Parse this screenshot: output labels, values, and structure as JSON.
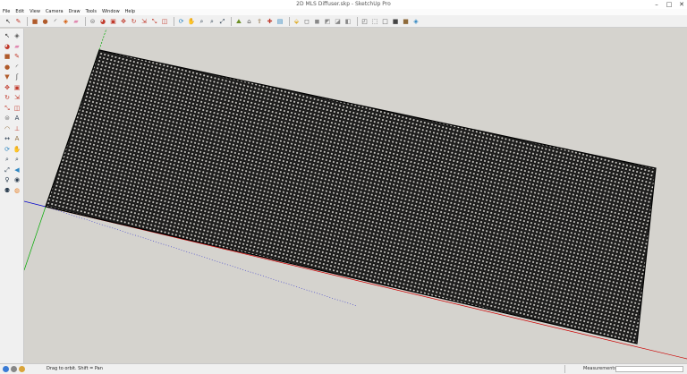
{
  "window": {
    "title": "2D MLS Diffuser.skp - SketchUp Pro"
  },
  "menu": [
    "File",
    "Edit",
    "View",
    "Camera",
    "Draw",
    "Tools",
    "Window",
    "Help"
  ],
  "toolbar_icons": [
    {
      "name": "select-icon",
      "glyph": "↖",
      "color": "#333333"
    },
    {
      "name": "pencil-icon",
      "glyph": "✎",
      "color": "#c0392b"
    },
    {
      "name": "rectangle-icon",
      "glyph": "■",
      "color": "#b05a2a"
    },
    {
      "name": "circle-icon",
      "glyph": "●",
      "color": "#b05a2a"
    },
    {
      "name": "arc-icon",
      "glyph": "◜",
      "color": "#444444"
    },
    {
      "name": "make-component-icon",
      "glyph": "◈",
      "color": "#d35400"
    },
    {
      "name": "eraser-icon",
      "glyph": "▰",
      "color": "#e088b0"
    },
    {
      "name": "tape-measure-icon",
      "glyph": "⊜",
      "color": "#777777"
    },
    {
      "name": "paint-bucket-icon",
      "glyph": "◕",
      "color": "#c0392b"
    },
    {
      "name": "push-pull-icon",
      "glyph": "▣",
      "color": "#c0392b"
    },
    {
      "name": "move-icon",
      "glyph": "✥",
      "color": "#c0392b"
    },
    {
      "name": "rotate-icon",
      "glyph": "↻",
      "color": "#c0392b"
    },
    {
      "name": "follow-me-icon",
      "glyph": "⇲",
      "color": "#c0392b"
    },
    {
      "name": "scale-icon",
      "glyph": "⤡",
      "color": "#c0392b"
    },
    {
      "name": "offset-icon",
      "glyph": "◫",
      "color": "#c0392b"
    },
    {
      "name": "orbit-icon",
      "glyph": "⟳",
      "color": "#2e86c1"
    },
    {
      "name": "pan-icon",
      "glyph": "✋",
      "color": "#8e6a3a"
    },
    {
      "name": "zoom-icon",
      "glyph": "⌕",
      "color": "#2c3e50"
    },
    {
      "name": "zoom-window-icon",
      "glyph": "⌕",
      "color": "#2c3e50"
    },
    {
      "name": "zoom-extents-icon",
      "glyph": "⤢",
      "color": "#2c3e50"
    },
    {
      "name": "add-location-icon",
      "glyph": "⛰",
      "color": "#6b8e23"
    },
    {
      "name": "warehouse-icon",
      "glyph": "⌂",
      "color": "#555555"
    },
    {
      "name": "share-model-icon",
      "glyph": "⇪",
      "color": "#8e6a3a"
    },
    {
      "name": "extension-warehouse-icon",
      "glyph": "✚",
      "color": "#c0392b"
    },
    {
      "name": "layout-icon",
      "glyph": "▤",
      "color": "#2e86c1"
    },
    {
      "name": "iso-view-icon",
      "glyph": "⬙",
      "color": "#e0b030"
    },
    {
      "name": "top-view-icon",
      "glyph": "◻",
      "color": "#555555"
    },
    {
      "name": "front-view-icon",
      "glyph": "◼",
      "color": "#888888"
    },
    {
      "name": "right-view-icon",
      "glyph": "◩",
      "color": "#888888"
    },
    {
      "name": "back-view-icon",
      "glyph": "◪",
      "color": "#888888"
    },
    {
      "name": "left-view-icon",
      "glyph": "◧",
      "color": "#888888"
    },
    {
      "name": "xray-icon",
      "glyph": "◰",
      "color": "#555555"
    },
    {
      "name": "wireframe-icon",
      "glyph": "⬚",
      "color": "#555555"
    },
    {
      "name": "hidden-line-icon",
      "glyph": "□",
      "color": "#555555"
    },
    {
      "name": "shaded-icon",
      "glyph": "■",
      "color": "#444444"
    },
    {
      "name": "shaded-textures-icon",
      "glyph": "■",
      "color": "#8e6a3a"
    },
    {
      "name": "monochrome-icon",
      "glyph": "◈",
      "color": "#2e86c1"
    }
  ],
  "left_tools": [
    {
      "name": "select-icon",
      "glyph": "↖",
      "color": "#333333"
    },
    {
      "name": "make-component-icon",
      "glyph": "◈",
      "color": "#555555"
    },
    {
      "name": "paint-bucket-icon",
      "glyph": "◕",
      "color": "#c0392b"
    },
    {
      "name": "eraser-icon",
      "glyph": "▰",
      "color": "#e088b0"
    },
    {
      "name": "rectangle-icon",
      "glyph": "■",
      "color": "#b05a2a"
    },
    {
      "name": "pencil-icon",
      "glyph": "✎",
      "color": "#c0392b"
    },
    {
      "name": "circle-icon",
      "glyph": "●",
      "color": "#b05a2a"
    },
    {
      "name": "arc-icon",
      "glyph": "◜",
      "color": "#444444"
    },
    {
      "name": "polygon-icon",
      "glyph": "▼",
      "color": "#b05a2a"
    },
    {
      "name": "freehand-icon",
      "glyph": "ʃ",
      "color": "#444444"
    },
    {
      "name": "move-icon",
      "glyph": "✥",
      "color": "#c0392b"
    },
    {
      "name": "push-pull-icon",
      "glyph": "▣",
      "color": "#c0392b"
    },
    {
      "name": "rotate-icon",
      "glyph": "↻",
      "color": "#c0392b"
    },
    {
      "name": "follow-me-icon",
      "glyph": "⇲",
      "color": "#c0392b"
    },
    {
      "name": "scale-icon",
      "glyph": "⤡",
      "color": "#c0392b"
    },
    {
      "name": "offset-icon",
      "glyph": "◫",
      "color": "#c0392b"
    },
    {
      "name": "tape-measure-icon",
      "glyph": "⊜",
      "color": "#777777"
    },
    {
      "name": "text-icon",
      "glyph": "A",
      "color": "#2c3e50"
    },
    {
      "name": "protractor-icon",
      "glyph": "◠",
      "color": "#8e6a3a"
    },
    {
      "name": "axes-icon",
      "glyph": "⊥",
      "color": "#c0392b"
    },
    {
      "name": "dimension-icon",
      "glyph": "↔",
      "color": "#2c3e50"
    },
    {
      "name": "3d-text-icon",
      "glyph": "A",
      "color": "#8e6a3a"
    },
    {
      "name": "orbit-icon",
      "glyph": "⟳",
      "color": "#2e86c1"
    },
    {
      "name": "pan-icon",
      "glyph": "✋",
      "color": "#8e6a3a"
    },
    {
      "name": "zoom-icon",
      "glyph": "⌕",
      "color": "#2c3e50"
    },
    {
      "name": "zoom-window-icon",
      "glyph": "⌕",
      "color": "#2c3e50"
    },
    {
      "name": "zoom-extents-icon",
      "glyph": "⤢",
      "color": "#2c3e50"
    },
    {
      "name": "previous-view-icon",
      "glyph": "◀",
      "color": "#2e86c1"
    },
    {
      "name": "position-camera-icon",
      "glyph": "♀",
      "color": "#2c3e50"
    },
    {
      "name": "look-around-icon",
      "glyph": "◉",
      "color": "#2c3e50"
    },
    {
      "name": "walk-icon",
      "glyph": "⚉",
      "color": "#2c3e50"
    },
    {
      "name": "section-plane-icon",
      "glyph": "◍",
      "color": "#e67e22"
    }
  ],
  "status": {
    "message": "Drag to orbit. Shift = Pan",
    "measurements_label": "Measurements",
    "measurements_value": ""
  },
  "colors": {
    "background": "#d5d3ce",
    "model_lines": "#000000",
    "axis_red": "#cc0000",
    "axis_green": "#00aa00",
    "axis_blue": "#0000cc"
  }
}
